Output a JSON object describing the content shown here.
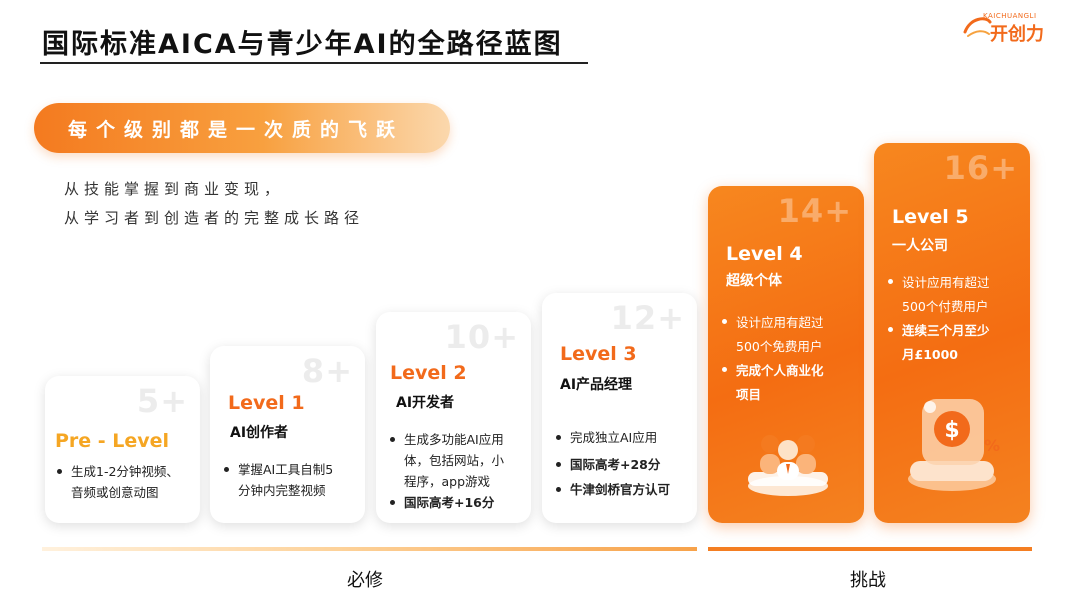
{
  "title": "国际标准AICA与青少年AI的全路径蓝图",
  "logo": {
    "small": "KAICHUANGLI",
    "main": "开创力"
  },
  "banner": "每个级别都是一次质的飞跃",
  "subtitle": [
    "从技能掌握到商业变现，",
    "从学习者到创造者的完整成长路径"
  ],
  "levels": [
    {
      "num": "5+",
      "level": "Pre - Level",
      "role": "",
      "bullets": [
        {
          "text": "生成1-2分钟视频、\n音频或创意动图",
          "bold": false
        }
      ]
    },
    {
      "num": "8+",
      "level": "Level 1",
      "role": "AI创作者",
      "bullets": [
        {
          "text": "掌握AI工具自制5\n分钟内完整视频",
          "bold": false
        }
      ]
    },
    {
      "num": "10+",
      "level": "Level 2",
      "role": "AI开发者",
      "bullets": [
        {
          "text": "生成多功能AI应用\n体，包括网站，小\n程序，app游戏",
          "bold": false
        },
        {
          "text": "国际高考+16分",
          "bold": true
        }
      ]
    },
    {
      "num": "12+",
      "level": "Level 3",
      "role": "AI产品经理",
      "bullets": [
        {
          "text": "完成独立AI应用",
          "bold": false
        },
        {
          "text": "国际高考+28分",
          "bold": true
        },
        {
          "text": "牛津剑桥官方认可",
          "bold": true
        }
      ]
    },
    {
      "num": "14+",
      "level": "Level 4",
      "role": "超级个体",
      "bullets": [
        {
          "text": "设计应用有超过\n500个免费用户",
          "bold": false
        },
        {
          "text": "完成个人商业化\n项目",
          "bold": true
        }
      ]
    },
    {
      "num": "16+",
      "level": "Level 5",
      "role": "一人公司",
      "bullets": [
        {
          "text": "设计应用有超过\n500个付费用户",
          "bold": false
        },
        {
          "text": "连续三个月至少\n月£1000",
          "bold": true
        }
      ]
    }
  ],
  "footer": {
    "required": "必修",
    "challenge": "挑战"
  },
  "colors": {
    "accent": "#f26a1b",
    "gold": "#f5a623"
  }
}
